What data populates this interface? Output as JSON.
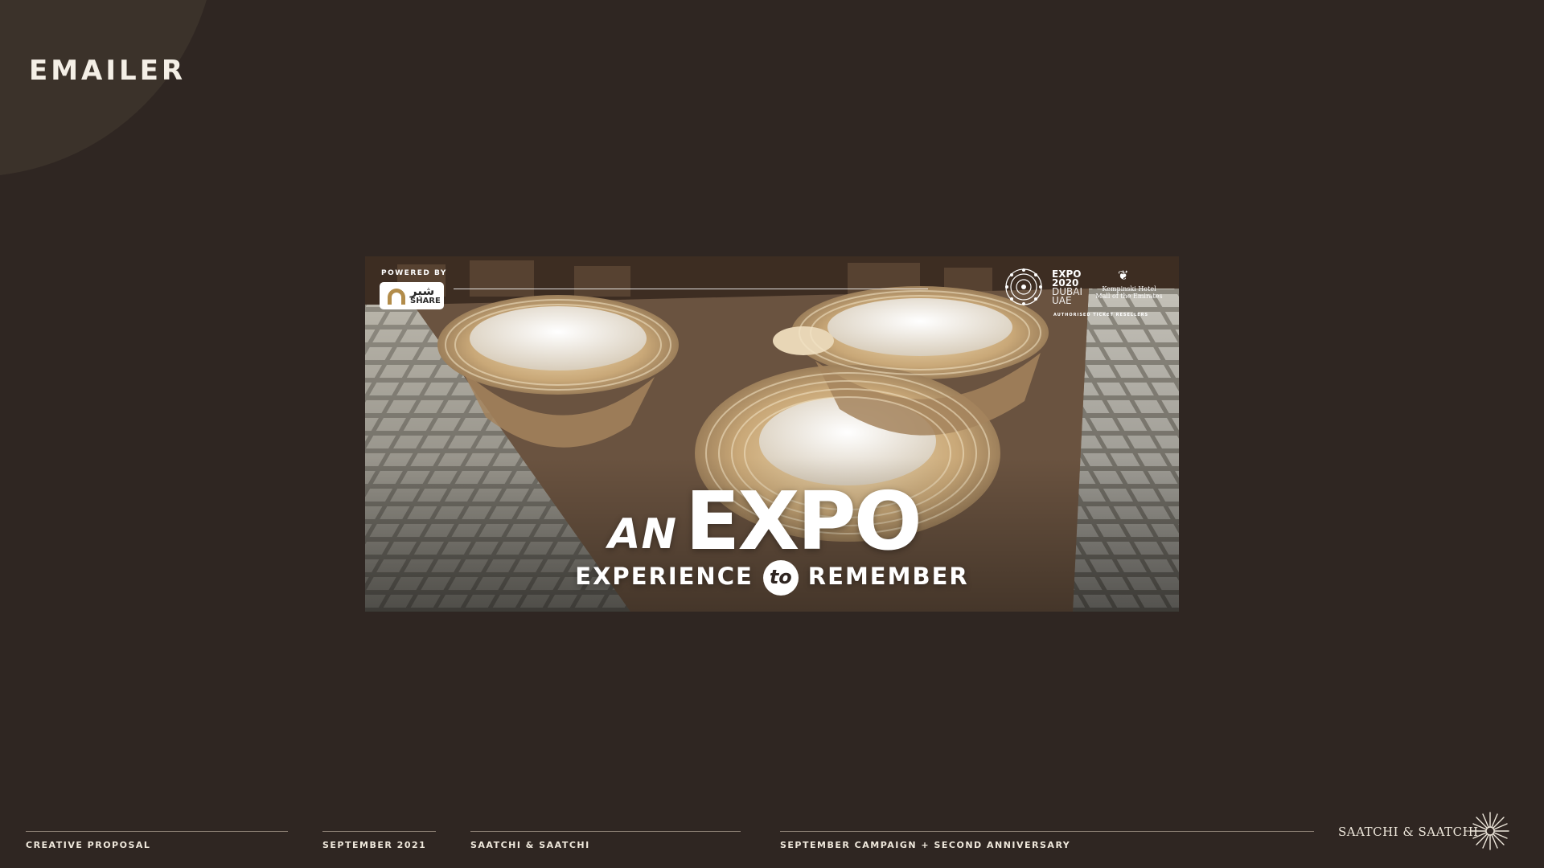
{
  "slide": {
    "title": "EMAILER"
  },
  "banner": {
    "powered_by": "POWERED BY",
    "share_logo": {
      "arabic": "شير",
      "latin": "SHARE"
    },
    "expo_logo": {
      "line1": "EXPO",
      "line2": "2020",
      "line3": "DUBAI",
      "line4": "UAE"
    },
    "kempinski": {
      "line1": "Kempinski Hotel",
      "line2": "Mall of the Emirates"
    },
    "reseller_note": "AUTHORISED TICKET RESELLERS",
    "headline": {
      "an": "AN",
      "expo": "EXPO",
      "experience": "EXPERIENCE",
      "to": "to",
      "remember": "REMEMBER"
    }
  },
  "footer": {
    "items": [
      {
        "label": "CREATIVE PROPOSAL"
      },
      {
        "label": "SEPTEMBER 2021"
      },
      {
        "label": "SAATCHI & SAATCHI"
      },
      {
        "label": "SEPTEMBER CAMPAIGN + SECOND ANNIVERSARY"
      }
    ],
    "brand": "SAATCHI & SAATCHI"
  },
  "colors": {
    "background": "#2f2622",
    "corner_shape": "#3b322a",
    "text_light": "#efe8dc",
    "gold": "#b28c4a"
  },
  "icons": {
    "expo_mark": "expo-2020-ring-icon",
    "kempinski": "kempinski-crest-icon",
    "brand": "saatchi-burst-icon"
  }
}
